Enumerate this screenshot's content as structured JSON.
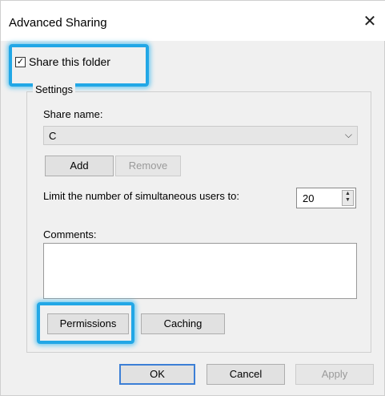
{
  "dialog": {
    "title": "Advanced Sharing",
    "close_glyph": "✕"
  },
  "share": {
    "checkbox_label": "Share this folder",
    "checked_glyph": "✓",
    "checked": true
  },
  "settings": {
    "group_title": "Settings",
    "share_name_label": "Share name:",
    "share_name_value": "C",
    "dropdown_arrow": "⌵",
    "add_label": "Add",
    "remove_label": "Remove",
    "limit_label": "Limit the number of simultaneous users to:",
    "limit_value": "20",
    "spin_up": "▲",
    "spin_down": "▼",
    "comments_label": "Comments:",
    "comments_value": "",
    "permissions_label": "Permissions",
    "caching_label": "Caching"
  },
  "footer": {
    "ok_label": "OK",
    "cancel_label": "Cancel",
    "apply_label": "Apply"
  },
  "colors": {
    "highlight": "#22a7e6",
    "default_button_border": "#3c7fd6"
  }
}
